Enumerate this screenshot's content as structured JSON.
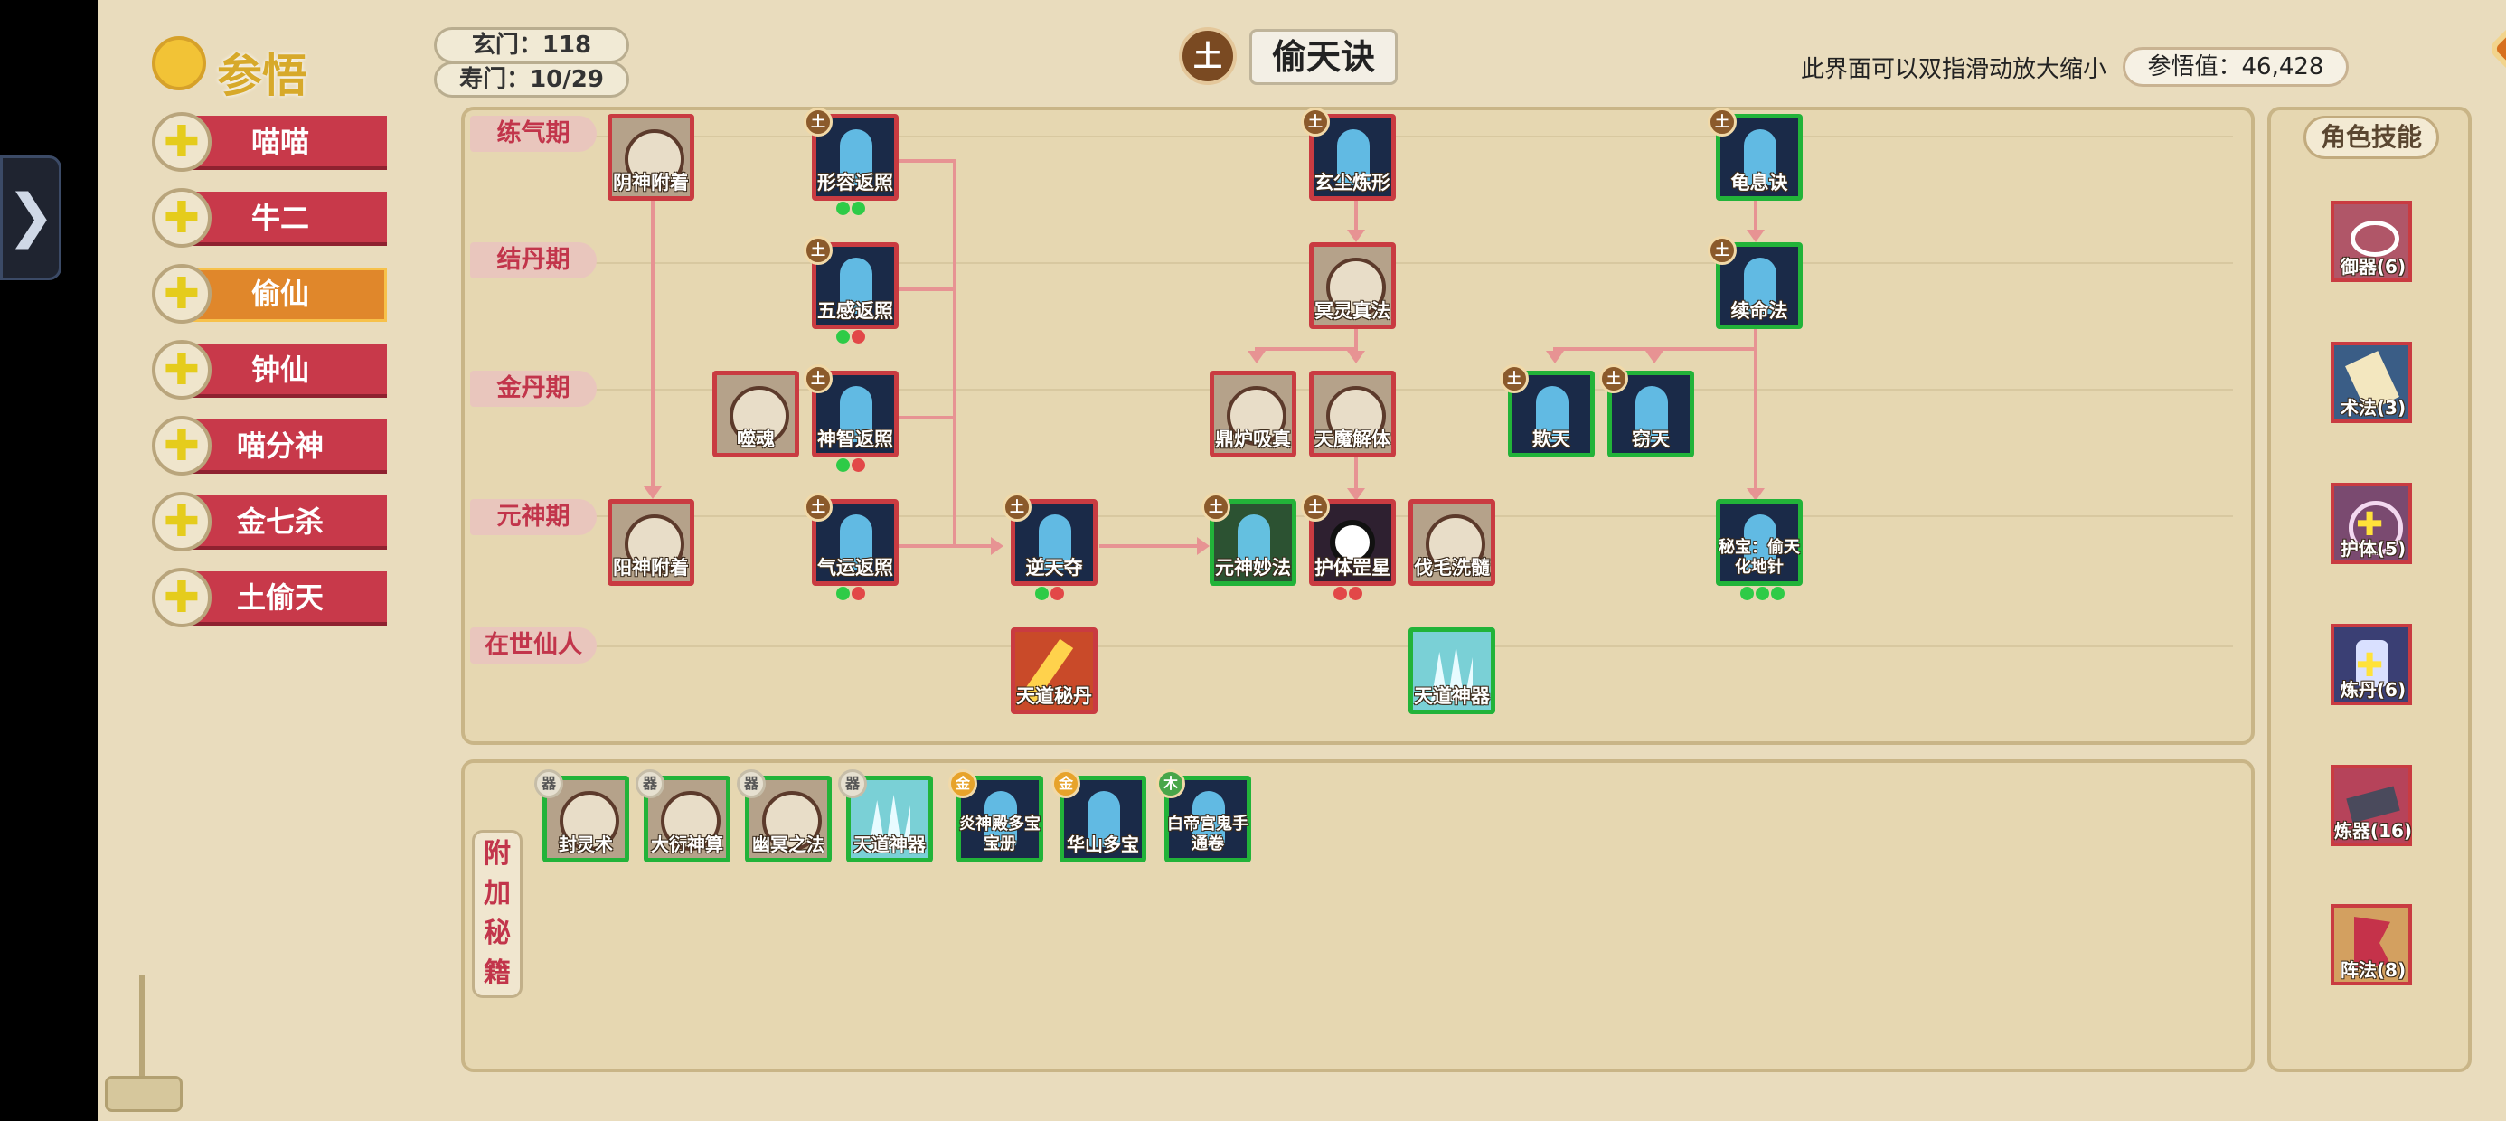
{
  "header": {
    "xuanmen": "玄门：118",
    "shoumen": "寿门：10/29",
    "element": "土",
    "title": "偷天诀",
    "hint": "此界面可以双指滑动放大缩小",
    "score": "参悟值：46,428",
    "close_icon": "close-x-icon"
  },
  "sidebar": {
    "title": "参悟",
    "items": [
      {
        "label": "喵喵",
        "icon": "plus-icon"
      },
      {
        "label": "牛二",
        "icon": "plus-icon"
      },
      {
        "label": "偷仙",
        "icon": "plus-icon"
      },
      {
        "label": "钟仙",
        "icon": "avatar-icon"
      },
      {
        "label": "喵分神",
        "icon": "plus-icon"
      },
      {
        "label": "金七杀",
        "icon": "plus-icon"
      },
      {
        "label": "土偷天",
        "icon": "avatar-icon"
      }
    ],
    "active_index": 2
  },
  "stages": [
    "练气期",
    "结丹期",
    "金丹期",
    "元神期",
    "在世仙人"
  ],
  "skills": {
    "s1": {
      "name": "阴神附着"
    },
    "s2": {
      "name": "形容返照",
      "tag": "土"
    },
    "s3": {
      "name": "五感返照",
      "tag": "土"
    },
    "s4": {
      "name": "神智返照",
      "tag": "土"
    },
    "s5": {
      "name": "气运返照",
      "tag": "土"
    },
    "s6": {
      "name": "噬魂"
    },
    "s7": {
      "name": "阳神附着"
    },
    "s8": {
      "name": "玄尘炼形",
      "tag": "土"
    },
    "s9": {
      "name": "冥灵真法"
    },
    "s10": {
      "name": "鼎炉吸真"
    },
    "s11": {
      "name": "天魔解体"
    },
    "s12": {
      "name": "护体罡星",
      "tag": "土"
    },
    "s13": {
      "name": "伐毛洗髓"
    },
    "s14": {
      "name": "逆天夺",
      "tag": "土"
    },
    "s15": {
      "name": "元神妙法",
      "tag": "土"
    },
    "s16": {
      "name": "龟息诀",
      "tag": "土"
    },
    "s17": {
      "name": "续命法",
      "tag": "土"
    },
    "s18": {
      "name": "欺天",
      "tag": "土"
    },
    "s19": {
      "name": "窃天",
      "tag": "土"
    },
    "s20": {
      "name": "秘宝：偷天化地针"
    },
    "s21": {
      "name": "天道秘丹"
    },
    "s22": {
      "name": "天道神器"
    }
  },
  "extra": {
    "label": "附加秘籍",
    "items": [
      {
        "name": "封灵术",
        "tag": "器"
      },
      {
        "name": "大衍神算",
        "tag": "器"
      },
      {
        "name": "幽冥之法",
        "tag": "器"
      },
      {
        "name": "天道神器",
        "tag": "器"
      },
      {
        "name": "炎神殿多宝宝册",
        "tag": "金"
      },
      {
        "name": "华山多宝",
        "tag": "金"
      },
      {
        "name": "白帝宫鬼手通卷",
        "tag": "木"
      }
    ]
  },
  "side": {
    "title": "角色技能",
    "items": [
      {
        "name": "御器(6)"
      },
      {
        "name": "术法(3)"
      },
      {
        "name": "护体(5)"
      },
      {
        "name": "炼丹(6)"
      },
      {
        "name": "炼器(16)"
      },
      {
        "name": "阵法(8)"
      }
    ]
  },
  "colors": {
    "accent_red": "#c8394a",
    "accent_orange": "#e0872b",
    "green_frame": "#22b339",
    "connector": "#e79393"
  }
}
